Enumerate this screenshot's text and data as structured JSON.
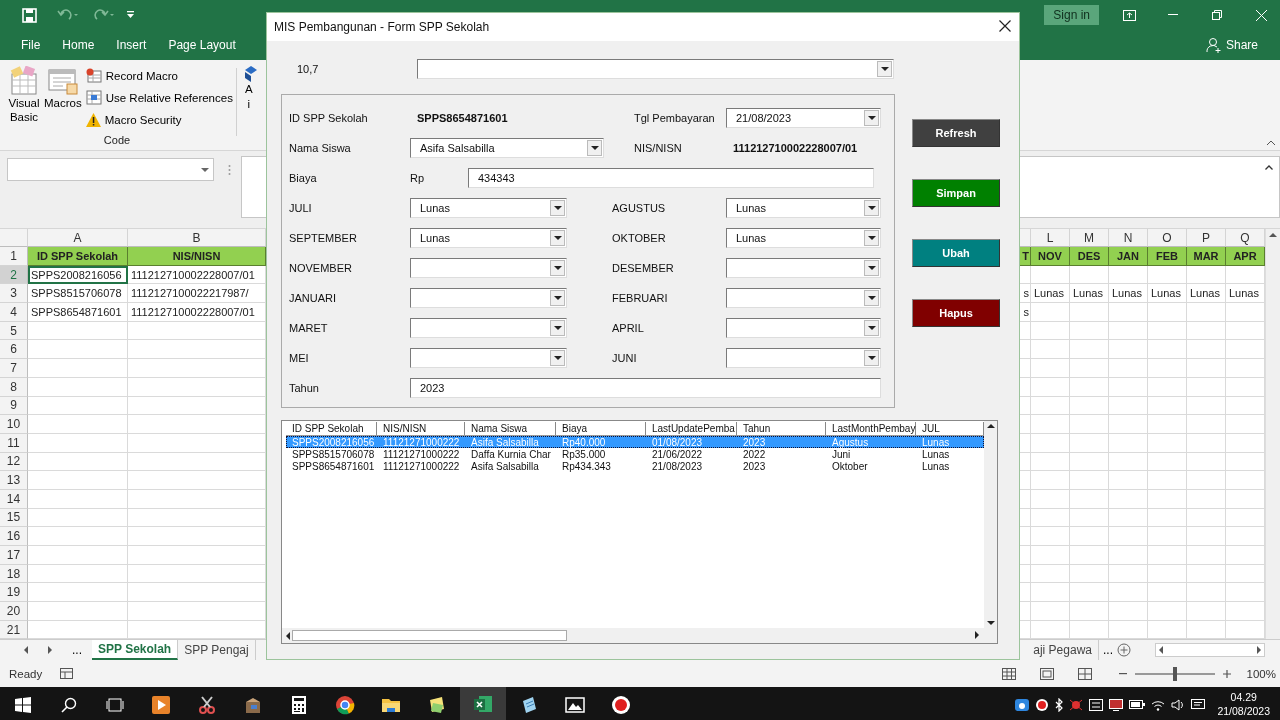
{
  "excel": {
    "sign_in": "Sign in",
    "tabs": [
      {
        "label": "File",
        "selected": false
      },
      {
        "label": "Home",
        "selected": false
      },
      {
        "label": "Insert",
        "selected": false
      },
      {
        "label": "Page Layout",
        "selected": false
      }
    ],
    "share": "Share",
    "ribbon": {
      "large_buttons": [
        "Visual Basic",
        "Macros"
      ],
      "small_buttons": [
        "Record Macro",
        "Use Relative References",
        "Macro Security"
      ],
      "group_label": "Code",
      "cut_button": [
        "A",
        "i"
      ]
    },
    "sheet": {
      "left_columns": [
        "A",
        "B"
      ],
      "right_columns": [
        "L",
        "M",
        "N",
        "O",
        "P",
        "Q"
      ],
      "rows": [
        {
          "number": "1",
          "kind": "header",
          "selected": false,
          "left": [
            "ID SPP Sekolah",
            "NIS/NISN"
          ],
          "cut": "T",
          "right": [
            "NOV",
            "DES",
            "JAN",
            "FEB",
            "MAR",
            "APR"
          ]
        },
        {
          "number": "2",
          "kind": "data",
          "selected": true,
          "left": [
            "SPPS2008216056",
            "111212710002228007/01"
          ]
        },
        {
          "number": "3",
          "kind": "data",
          "selected": false,
          "left": [
            "SPPS8515706078",
            "1112127100022217987/"
          ],
          "cut": "s",
          "right": [
            "Lunas",
            "Lunas",
            "Lunas",
            "Lunas",
            "Lunas",
            "Lunas"
          ]
        },
        {
          "number": "4",
          "kind": "data",
          "selected": false,
          "left": [
            "SPPS8654871601",
            "111212710002228007/01"
          ],
          "cut": "s"
        },
        {
          "number": "5",
          "kind": "data",
          "selected": false
        },
        {
          "number": "6",
          "kind": "data",
          "selected": false
        },
        {
          "number": "7",
          "kind": "data",
          "selected": false
        },
        {
          "number": "8",
          "kind": "data",
          "selected": false
        },
        {
          "number": "9",
          "kind": "data",
          "selected": false
        },
        {
          "number": "10",
          "kind": "data",
          "selected": false
        },
        {
          "number": "11",
          "kind": "data",
          "selected": false
        },
        {
          "number": "12",
          "kind": "data",
          "selected": false
        },
        {
          "number": "13",
          "kind": "data",
          "selected": false
        },
        {
          "number": "14",
          "kind": "data",
          "selected": false
        },
        {
          "number": "15",
          "kind": "data",
          "selected": false
        },
        {
          "number": "16",
          "kind": "data",
          "selected": false
        },
        {
          "number": "17",
          "kind": "data",
          "selected": false
        },
        {
          "number": "18",
          "kind": "data",
          "selected": false
        },
        {
          "number": "19",
          "kind": "data",
          "selected": false
        },
        {
          "number": "20",
          "kind": "data",
          "selected": false
        },
        {
          "number": "21",
          "kind": "data",
          "selected": false
        }
      ]
    },
    "sheet_tabs": {
      "more": "...",
      "tabs": [
        {
          "label": "SPP Sekolah",
          "selected": true
        },
        {
          "label": "SPP Pengaj",
          "selected": false
        }
      ],
      "right_tab": "aji Pegawa",
      "right_more": "..."
    },
    "status": {
      "text": "Ready",
      "zoom": {
        "level": 0.5
      },
      "zoom_reading": "100%"
    }
  },
  "taskbar": {
    "apps": [
      {
        "kind": "play",
        "selected": false
      },
      {
        "kind": "scissors",
        "selected": false
      },
      {
        "kind": "package",
        "selected": false
      },
      {
        "kind": "calculator",
        "selected": false
      },
      {
        "kind": "browser",
        "selected": false
      },
      {
        "kind": "folder",
        "selected": false
      },
      {
        "kind": "notes",
        "selected": false
      },
      {
        "kind": "spreadsheet",
        "selected": true
      },
      {
        "kind": "document",
        "selected": false
      },
      {
        "kind": "picture",
        "selected": false
      },
      {
        "kind": "record",
        "selected": false
      }
    ],
    "time": "04.29",
    "date": "21/08/2023"
  },
  "dialog": {
    "title": "MIS Pembangunan - Form SPP Sekolah",
    "top_label": "10,7",
    "form": {
      "id_label": "ID SPP Sekolah",
      "id_value": "SPPS8654871601",
      "date_label": "Tgl Pembayaran",
      "date_value": "21/08/2023",
      "name_label": "Nama Siswa",
      "name_value": "Asifa Salsabilla",
      "nis_label": "NIS/NISN",
      "nis_value": "111212710002228007/01",
      "fee_label": "Biaya",
      "currency": "Rp",
      "fee_value": "434343",
      "months": [
        {
          "label": "JULI",
          "value": "Lunas"
        },
        {
          "label": "AGUSTUS",
          "value": "Lunas"
        },
        {
          "label": "SEPTEMBER",
          "value": "Lunas"
        },
        {
          "label": "OKTOBER",
          "value": "Lunas"
        },
        {
          "label": "NOVEMBER"
        },
        {
          "label": "DESEMBER"
        },
        {
          "label": "JANUARI"
        },
        {
          "label": "FEBRUARI"
        },
        {
          "label": "MARET"
        },
        {
          "label": "APRIL"
        },
        {
          "label": "MEI"
        },
        {
          "label": "JUNI"
        }
      ],
      "year_label": "Tahun",
      "year_value": "2023"
    },
    "buttons": [
      {
        "label": "Refresh",
        "color": "#404040"
      },
      {
        "label": "Simpan",
        "color": "#008000"
      },
      {
        "label": "Ubah",
        "color": "#008080"
      },
      {
        "label": "Hapus",
        "color": "#800000"
      }
    ],
    "list": {
      "columns": [
        "ID SPP Sekolah",
        "NIS/NISN",
        "Nama Siswa",
        "Biaya",
        "LastUpdatePemba",
        "Tahun",
        "LastMonthPembay",
        "JUL"
      ],
      "rows": [
        {
          "selected": true,
          "cells": [
            "SPPS2008216056",
            "11121271000222",
            "Asifa Salsabilla",
            "Rp40.000",
            "01/08/2023",
            "2023",
            "Agustus",
            "Lunas"
          ]
        },
        {
          "selected": false,
          "cells": [
            "SPPS8515706078",
            "11121271000222",
            "Daffa Kurnia Char",
            "Rp35.000",
            "21/06/2022",
            "2022",
            "Juni",
            "Lunas"
          ]
        },
        {
          "selected": false,
          "cells": [
            "SPPS8654871601",
            "11121271000222",
            "Asifa Salsabilla",
            "Rp434.343",
            "21/08/2023",
            "2023",
            "Oktober",
            "Lunas"
          ]
        }
      ]
    }
  }
}
